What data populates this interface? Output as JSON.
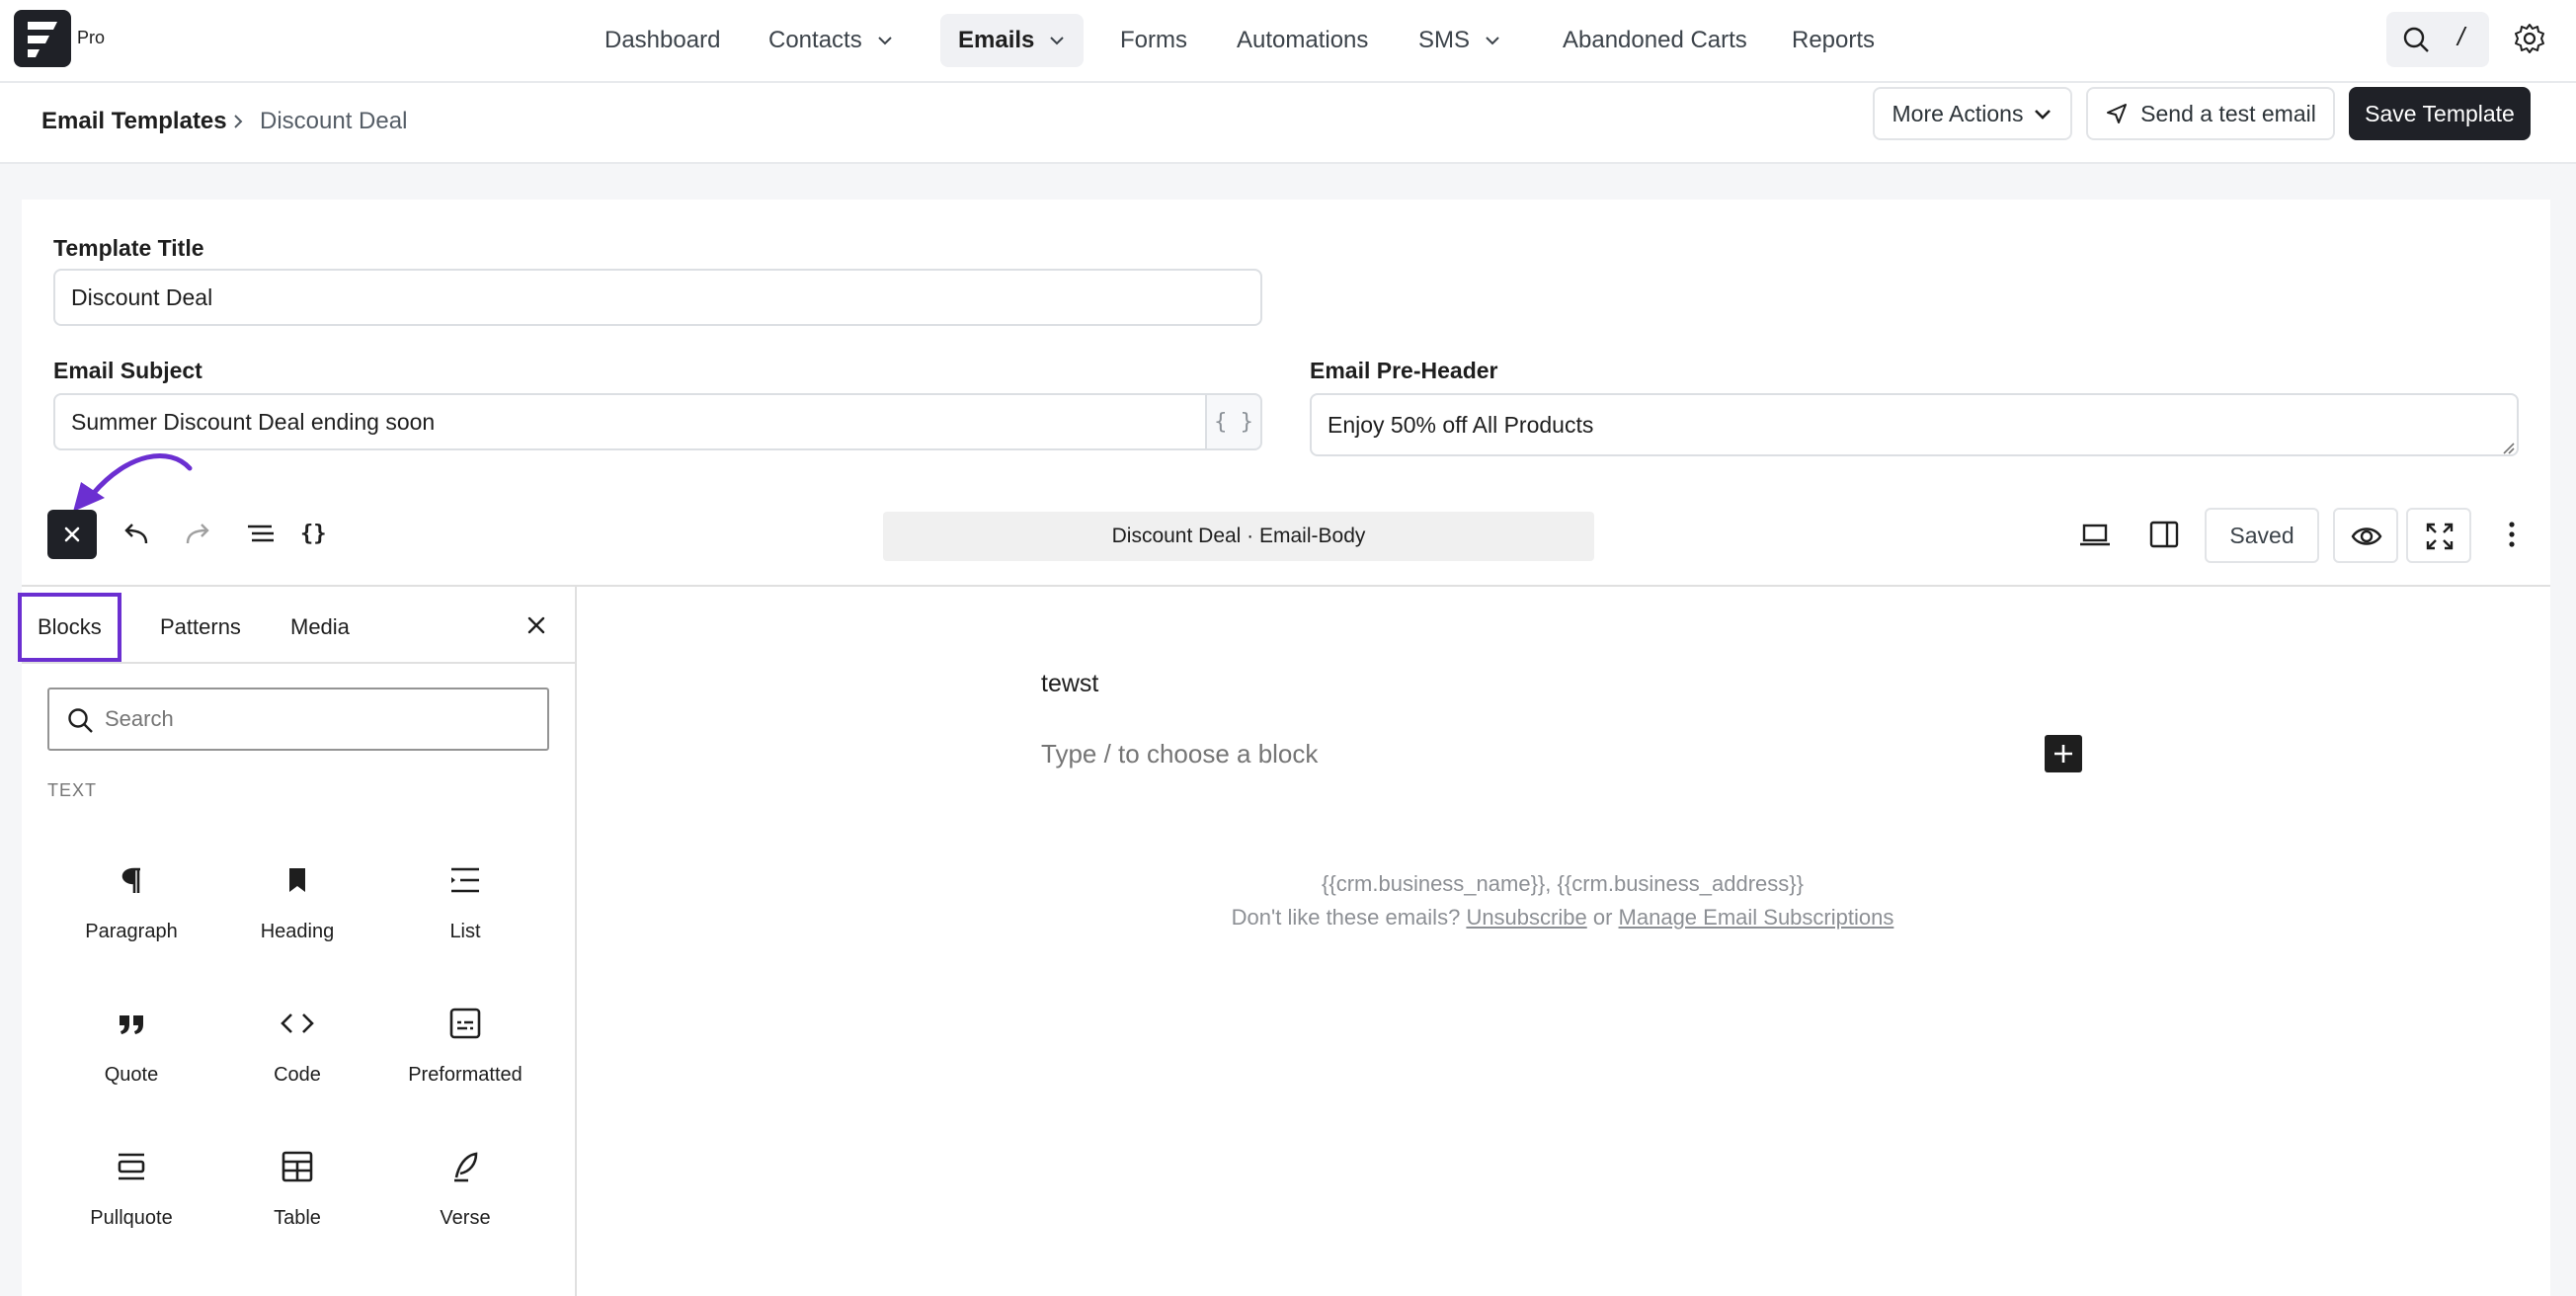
{
  "brand": {
    "plan": "Pro"
  },
  "nav": {
    "items": [
      {
        "label": "Dashboard"
      },
      {
        "label": "Contacts"
      },
      {
        "label": "Emails"
      },
      {
        "label": "Forms"
      },
      {
        "label": "Automations"
      },
      {
        "label": "SMS"
      },
      {
        "label": "Abandoned Carts"
      },
      {
        "label": "Reports"
      }
    ],
    "active": "Emails",
    "shortcut": "/"
  },
  "breadcrumb": {
    "root": "Email Templates",
    "current": "Discount Deal"
  },
  "actions": {
    "more": "More Actions",
    "test": "Send a test email",
    "save": "Save Template"
  },
  "form": {
    "title_label": "Template Title",
    "title_value": "Discount Deal",
    "subject_label": "Email Subject",
    "subject_value": "Summer Discount Deal ending soon",
    "merge_tag": "{ }",
    "preheader_label": "Email Pre-Header",
    "preheader_value": "Enjoy 50% off All Products"
  },
  "editor": {
    "doc_title": "Discount Deal · Email-Body",
    "saved": "Saved",
    "code_icon_text": "{}"
  },
  "inserter": {
    "tabs": [
      {
        "label": "Blocks"
      },
      {
        "label": "Patterns"
      },
      {
        "label": "Media"
      }
    ],
    "active_tab": "Blocks",
    "search_placeholder": "Search",
    "category": "TEXT",
    "blocks": [
      {
        "label": "Paragraph",
        "icon": "paragraph-icon"
      },
      {
        "label": "Heading",
        "icon": "heading-icon"
      },
      {
        "label": "List",
        "icon": "list-icon"
      },
      {
        "label": "Quote",
        "icon": "quote-icon"
      },
      {
        "label": "Code",
        "icon": "code-icon"
      },
      {
        "label": "Preformatted",
        "icon": "preformatted-icon"
      },
      {
        "label": "Pullquote",
        "icon": "pullquote-icon"
      },
      {
        "label": "Table",
        "icon": "table-icon"
      },
      {
        "label": "Verse",
        "icon": "verse-icon"
      }
    ]
  },
  "canvas": {
    "text": "tewst",
    "placeholder": "Type / to choose a block",
    "footer_line1": "{{crm.business_name}}, {{crm.business_address}}",
    "footer_prefix": "Don't like these emails?",
    "footer_unsub": "Unsubscribe",
    "footer_or": "or",
    "footer_manage": "Manage Email Subscriptions"
  },
  "colors": {
    "accent": "#6b2fd1",
    "dark": "#1f2127"
  }
}
